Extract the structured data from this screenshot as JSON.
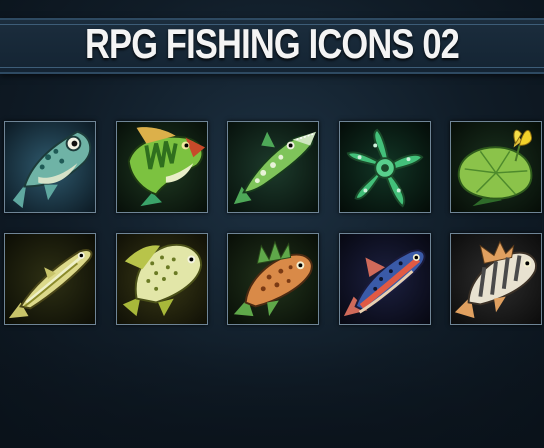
{
  "title": "RPG FISHING ICONS 02",
  "colors": {
    "background": "#101c27",
    "banner": "#1b2d3d",
    "title_text": "#f4f4f4",
    "tile_border": "#6f8596"
  },
  "icons": [
    {
      "name": "teal-spotted-fish-icon",
      "row": 1,
      "col": 1
    },
    {
      "name": "green-bass-icon",
      "row": 1,
      "col": 2
    },
    {
      "name": "green-pike-icon",
      "row": 1,
      "col": 3
    },
    {
      "name": "green-starfish-icon",
      "row": 1,
      "col": 4
    },
    {
      "name": "lily-pad-flower-icon",
      "row": 1,
      "col": 5
    },
    {
      "name": "yellow-herring-icon",
      "row": 2,
      "col": 1
    },
    {
      "name": "yellow-spotted-bream-icon",
      "row": 2,
      "col": 2
    },
    {
      "name": "orange-rockfish-icon",
      "row": 2,
      "col": 3
    },
    {
      "name": "red-blue-trout-icon",
      "row": 2,
      "col": 4
    },
    {
      "name": "striped-perch-icon",
      "row": 2,
      "col": 5
    }
  ]
}
